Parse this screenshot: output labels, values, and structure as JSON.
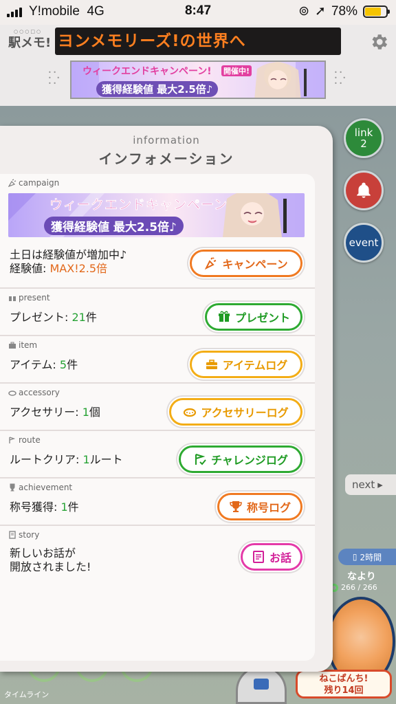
{
  "status_bar": {
    "carrier": "Y!mobile",
    "network": "4G",
    "time": "8:47",
    "battery": "78%",
    "battery_level": 0.78
  },
  "header": {
    "logo": "駅メモ!",
    "logo_sub": "○○○□○",
    "ticker": "ヨンメモリーズ!の世界へ"
  },
  "top_banner": {
    "title": "ウィークエンドキャンペーン!",
    "tag": "開催中!",
    "subtitle": "獲得経験値 最大2.5倍♪"
  },
  "side_buttons": {
    "link_label": "link",
    "link_count": "2",
    "event_label": "event"
  },
  "panel": {
    "title_en": "information",
    "title_jp": "インフォメーション"
  },
  "campaign": {
    "label": "campaign",
    "banner_title": "ウィークエンドキャンペーン",
    "banner_subtitle": "獲得経験値 最大2.5倍♪",
    "text_line1": "土日は経験値が増加中♪",
    "text_prefix": "経験値: ",
    "text_value": "MAX!2.5倍",
    "button": "キャンペーン"
  },
  "present": {
    "label": "present",
    "text": "プレゼント: ",
    "count": "21",
    "unit": "件",
    "button": "プレゼント"
  },
  "item": {
    "label": "item",
    "text": "アイテム: ",
    "count": "5",
    "unit": "件",
    "button": "アイテムログ"
  },
  "accessory": {
    "label": "accessory",
    "text": "アクセサリー: ",
    "count": "1",
    "unit": "個",
    "button": "アクセサリーログ"
  },
  "route": {
    "label": "route",
    "text": "ルートクリア: ",
    "count": "1",
    "unit": "ルート",
    "button": "チャレンジログ"
  },
  "achievement": {
    "label": "achievement",
    "text": "称号獲得: ",
    "count": "1",
    "unit": "件",
    "button": "称号ログ"
  },
  "story": {
    "label": "story",
    "text_line1": "新しいお話が",
    "text_line2": "開放されました!",
    "button": "お話"
  },
  "background": {
    "next_tab": "next",
    "time_badge": "2時間",
    "partner_name": "なより",
    "hp": "266 / 266",
    "timeline": "タイムライン",
    "neko_line1": "ねこぱんち!",
    "neko_line2": "残り14回"
  },
  "colors": {
    "orange": "#f07a22",
    "green": "#2eaa32",
    "yellow": "#f3ad16",
    "pink": "#e43aa8",
    "link_green": "#2d8a3a",
    "bell_red": "#c8403a",
    "event_blue": "#1f4f88"
  }
}
